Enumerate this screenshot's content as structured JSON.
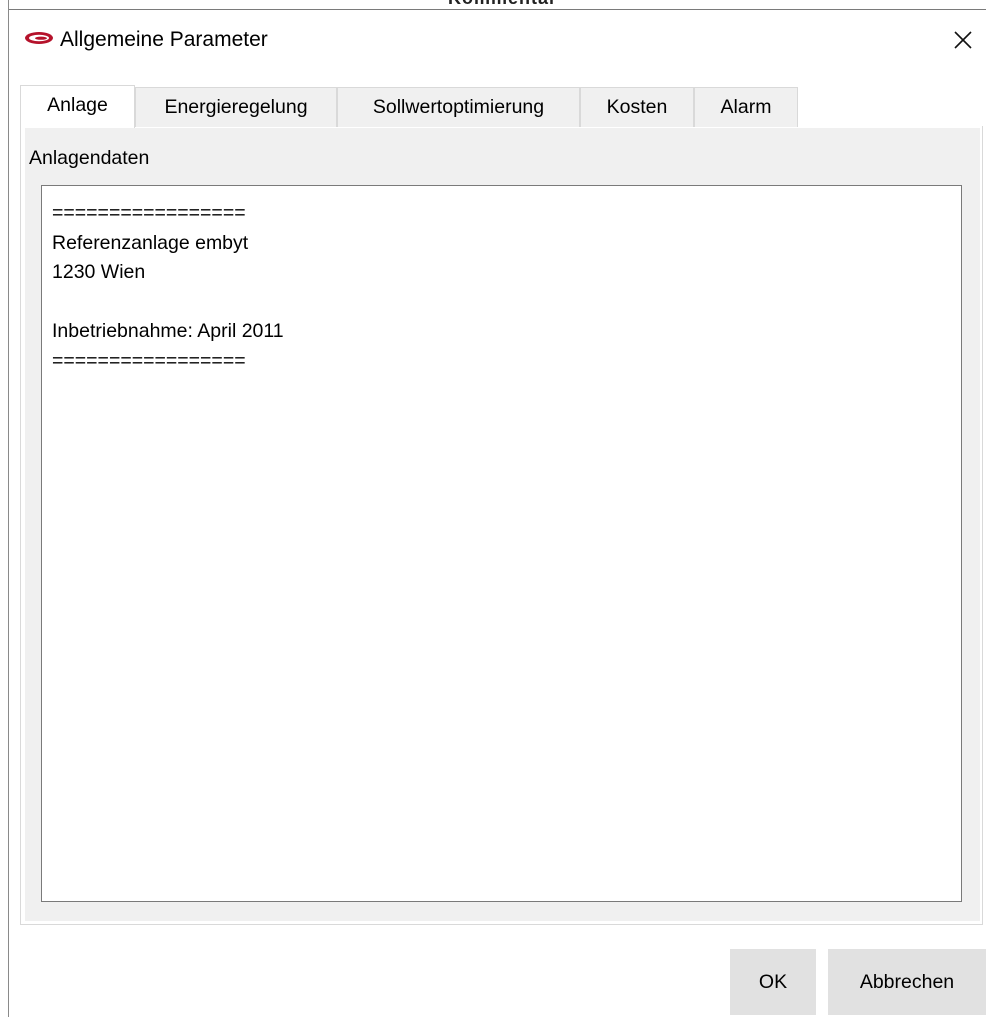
{
  "background_window": {
    "partial_title": "Kommentar"
  },
  "dialog": {
    "title": "Allgemeine Parameter",
    "icon": "app-logo-icon",
    "close_icon": "close-icon"
  },
  "tabs": [
    {
      "label": "Anlage",
      "active": true
    },
    {
      "label": "Energieregelung",
      "active": false
    },
    {
      "label": "Sollwertoptimierung",
      "active": false
    },
    {
      "label": "Kosten",
      "active": false
    },
    {
      "label": "Alarm",
      "active": false
    }
  ],
  "anlage": {
    "group_label": "Anlagendaten",
    "text": "=================\nReferenzanlage embyt\n1230 Wien\n\nInbetriebnahme: April 2011\n================="
  },
  "buttons": {
    "ok": "OK",
    "cancel": "Abbrechen"
  },
  "colors": {
    "window_bg": "#ffffff",
    "panel_bg": "#f0f0f0",
    "button_bg": "#e1e1e1",
    "border": "#7a7a7a",
    "logo_red": "#b5122b"
  }
}
